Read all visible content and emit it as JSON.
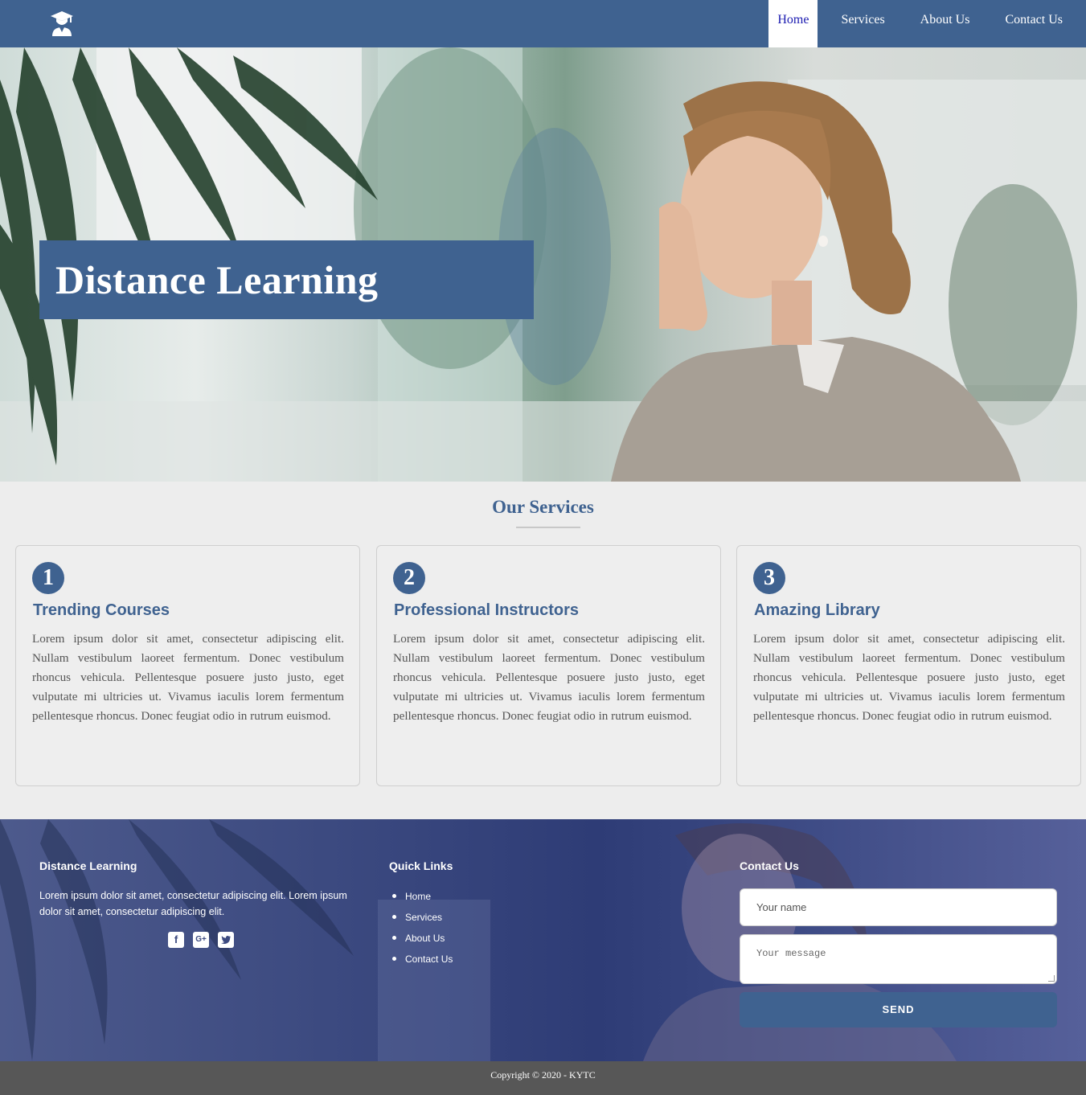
{
  "nav": {
    "items": [
      {
        "label": "Home",
        "active": true
      },
      {
        "label": "Services"
      },
      {
        "label": "About Us"
      },
      {
        "label": "Contact Us"
      }
    ]
  },
  "logo": {
    "icon": "graduate-icon"
  },
  "hero": {
    "title": "Distance Learning"
  },
  "services": {
    "title": "Our Services",
    "cards": [
      {
        "number": "1",
        "title": "Trending Courses",
        "text": "Lorem ipsum dolor sit amet, consectetur adipiscing elit. Nullam vestibulum laoreet fermentum. Donec vestibulum rhoncus vehicula. Pellentesque posuere justo justo, eget vulputate mi ultricies ut. Vivamus iaculis lorem fermentum pellentesque rhoncus. Donec feugiat odio in rutrum euismod."
      },
      {
        "number": "2",
        "title": "Professional Instructors",
        "text": "Lorem ipsum dolor sit amet, consectetur adipiscing elit. Nullam vestibulum laoreet fermentum. Donec vestibulum rhoncus vehicula. Pellentesque posuere justo justo, eget vulputate mi ultricies ut. Vivamus iaculis lorem fermentum pellentesque rhoncus. Donec feugiat odio in rutrum euismod."
      },
      {
        "number": "3",
        "title": "Amazing Library",
        "text": "Lorem ipsum dolor sit amet, consectetur adipiscing elit. Nullam vestibulum laoreet fermentum. Donec vestibulum rhoncus vehicula. Pellentesque posuere justo justo, eget vulputate mi ultricies ut. Vivamus iaculis lorem fermentum pellentesque rhoncus. Donec feugiat odio in rutrum euismod."
      }
    ]
  },
  "footer": {
    "about": {
      "title": "Distance Learning",
      "text": "Lorem ipsum dolor sit amet, consectetur adipiscing elit. Lorem ipsum dolor sit amet, consectetur adipiscing elit.",
      "social": [
        "facebook-icon",
        "google-plus-icon",
        "twitter-icon"
      ]
    },
    "links": {
      "title": "Quick Links",
      "items": [
        "Home",
        "Services",
        "About Us",
        "Contact Us"
      ]
    },
    "contact": {
      "title": "Contact Us",
      "name_placeholder": "Your name",
      "message_placeholder": "Your message",
      "send_label": "SEND"
    }
  },
  "copyright": "Copyright © 2020 - KYTC",
  "colors": {
    "primary": "#3f6290",
    "background": "#ededed",
    "copyright_bar": "#575757"
  }
}
